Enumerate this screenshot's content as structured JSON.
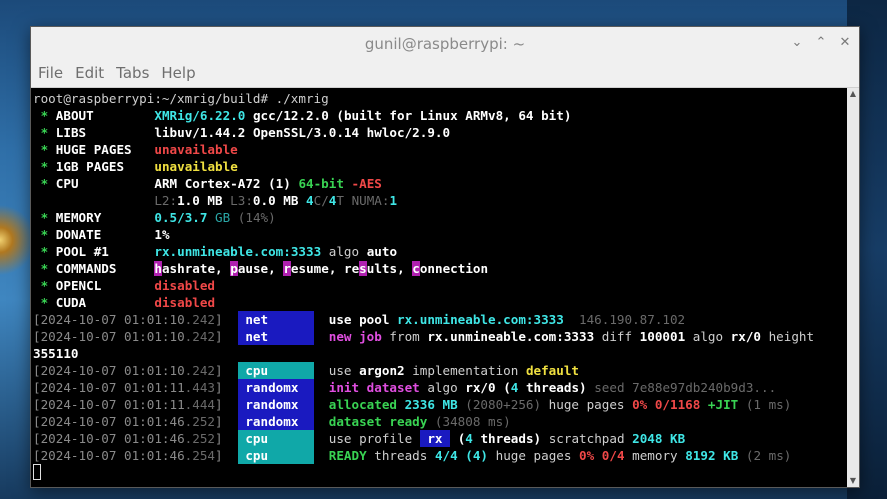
{
  "window": {
    "title": "gunil@raspberrypi: ~"
  },
  "menu": [
    "File",
    "Edit",
    "Tabs",
    "Help"
  ],
  "prompt": "root@raspberrypi:~/xmrig/build# ./xmrig",
  "info": {
    "about_key": "ABOUT",
    "about_val": "XMRig/6.22.0",
    "about_rest": " gcc/12.2.0 (built for Linux ARMv8, 64 bit)",
    "libs_key": "LIBS",
    "libs_val": "libuv/1.44.2 OpenSSL/3.0.14 hwloc/2.9.0",
    "huge_key": "HUGE PAGES",
    "huge_val": "unavailable",
    "gb_key": "1GB PAGES",
    "gb_val": "unavailable",
    "cpu_key": "CPU",
    "cpu_val": "ARM Cortex-A72 (1)",
    "cpu_64": "64-bit",
    "cpu_aes": "-AES",
    "l2_label": "L2:",
    "l2_val": "1.0 MB",
    "l3_label": "L3:",
    "l3_val": "0.0 MB",
    "cores": "4",
    "cores_suffix": "C/",
    "threads": "4",
    "threads_suffix": "T",
    "numa_label": "NUMA:",
    "numa_val": "1",
    "mem_key": "MEMORY",
    "mem_val": "0.5/3.7",
    "mem_unit": "GB",
    "mem_pct": "(14%)",
    "donate_key": "DONATE",
    "donate_val": "1%",
    "pool_key": "POOL #1",
    "pool_val": "rx.unmineable.com:3333",
    "pool_algo": "algo",
    "pool_algo_val": "auto",
    "commands_key": "COMMANDS",
    "cmd_h": "h",
    "cmd_h_rest": "ashrate, ",
    "cmd_p": "p",
    "cmd_p_rest": "ause, ",
    "cmd_r": "r",
    "cmd_r_rest": "esume, ",
    "cmd_res": "re",
    "cmd_s": "s",
    "cmd_s_rest": "ults, ",
    "cmd_c": "c",
    "cmd_c_rest": "onnection",
    "opencl_key": "OPENCL",
    "opencl_val": "disabled",
    "cuda_key": "CUDA",
    "cuda_val": "disabled"
  },
  "log": {
    "l1_ts": "2024-10-07 01:01:10",
    "l1_ms": ".242",
    "l1_tag": " net      ",
    "l1_a": "use pool ",
    "l1_b": "rx.unmineable.com:3333",
    "l1_c": "  146.190.87.102",
    "l2_ts": "2024-10-07 01:01:10",
    "l2_ms": ".242",
    "l2_tag": " net      ",
    "l2_a": "new job",
    "l2_b": " from ",
    "l2_c": "rx.unmineable.com:3333",
    "l2_d": " diff ",
    "l2_e": "100001",
    "l2_f": " algo ",
    "l2_g": "rx/0",
    "l2_h": " height",
    "l2_height": "355110",
    "l3_ts": "2024-10-07 01:01:10",
    "l3_ms": ".242",
    "l3_tag": " cpu      ",
    "l3_a": "use ",
    "l3_b": "argon2",
    "l3_c": " implementation ",
    "l3_d": "default",
    "l4_ts": "2024-10-07 01:01:11",
    "l4_ms": ".443",
    "l4_tag": " randomx  ",
    "l4_a": "init dataset",
    "l4_b": " algo ",
    "l4_c": "rx/0",
    "l4_d": " (",
    "l4_e": "4",
    "l4_f": " threads)",
    "l4_g": " seed 7e88e97db240b9d3...",
    "l5_ts": "2024-10-07 01:01:11",
    "l5_ms": ".444",
    "l5_tag": " randomx  ",
    "l5_a": "allocated",
    "l5_b": " 2336 MB",
    "l5_c": " (2080+256)",
    "l5_d": " huge pages ",
    "l5_e": "0% 0/1168",
    "l5_f": " +JIT",
    "l5_g": " (1 ms)",
    "l6_ts": "2024-10-07 01:01:46",
    "l6_ms": ".252",
    "l6_tag": " randomx  ",
    "l6_a": "dataset ready",
    "l6_b": " (34808 ms)",
    "l7_ts": "2024-10-07 01:01:46",
    "l7_ms": ".252",
    "l7_tag": " cpu      ",
    "l7_a": "use profile ",
    "l7_b": " rx ",
    "l7_c": " (",
    "l7_d": "4",
    "l7_e": " threads)",
    "l7_f": " scratchpad ",
    "l7_g": "2048 KB",
    "l8_ts": "2024-10-07 01:01:46",
    "l8_ms": ".254",
    "l8_tag": " cpu      ",
    "l8_a": "READY",
    "l8_b": " threads ",
    "l8_c": "4/4",
    "l8_d": " (4)",
    "l8_e": " huge pages ",
    "l8_f": "0% 0/4",
    "l8_g": " memory ",
    "l8_h": "8192 KB",
    "l8_i": " (2 ms)"
  }
}
